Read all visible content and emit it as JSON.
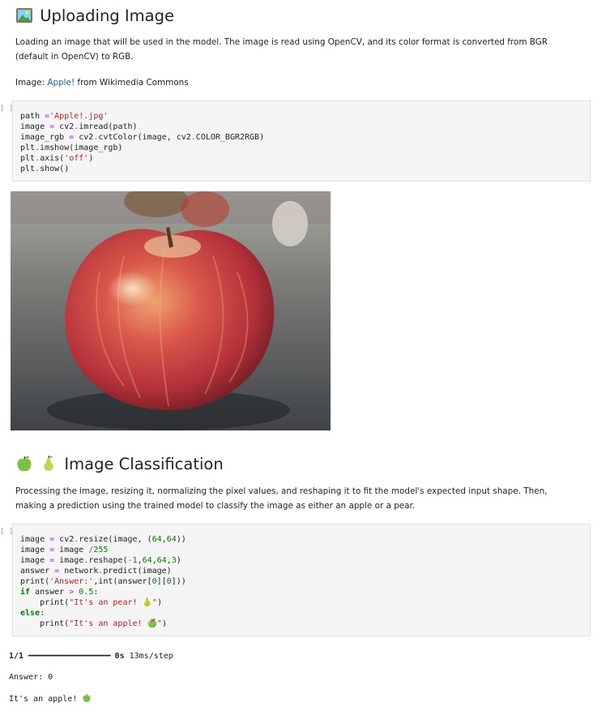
{
  "section1": {
    "heading": "Uploading Image",
    "heading_icon": "framed-picture-icon",
    "desc": "Loading an image that will be used in the model. The image is read using OpenCV, and its color format is converted from BGR (default in OpenCV) to RGB.",
    "image_label": "Image:",
    "image_link": "Apple!",
    "image_source": "from Wikimedia Commons",
    "prompt": "[ ]:",
    "image_alt": "red apple on a granite countertop"
  },
  "section2": {
    "heading": "Image Classification",
    "heading_icons": [
      "green-apple-icon",
      "pear-icon"
    ],
    "desc": "Processing the image, resizing it, normalizing the pixel values, and reshaping it to fit the model's expected input shape. Then, making a prediction using the trained model to classify the image as either an apple or a pear.",
    "prompt": "[ ]:",
    "output": {
      "progress_count": "1/1",
      "progress_bar": "━━━━━━━━━━━━━━━━━━━━",
      "elapsed": "0s",
      "per_step": "13ms/step",
      "answer_line": "Answer: 0",
      "result_line": "It's an apple! "
    }
  },
  "colors": {
    "link": "#1a5fb4",
    "code_bg": "#f5f5f5",
    "keyword": "#008000",
    "string": "#ba2121",
    "operator": "#aa22ff"
  }
}
